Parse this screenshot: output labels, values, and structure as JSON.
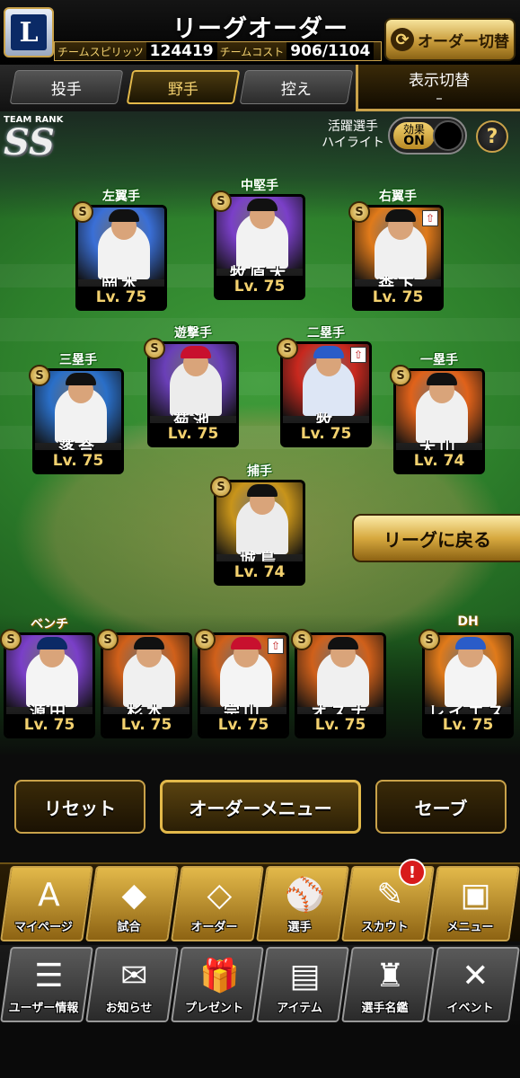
{
  "header": {
    "title": "リーグオーダー",
    "logo_letter": "L",
    "spirit_label": "チームスピリッツ",
    "spirit_value": "124419",
    "cost_label": "チームコスト",
    "cost_value": "906/1104",
    "order_switch_label": "オーダー切替"
  },
  "tabs": [
    {
      "label": "投手",
      "active": false
    },
    {
      "label": "野手",
      "active": true
    },
    {
      "label": "控え",
      "active": false
    }
  ],
  "display_toggle": {
    "label": "表示切替",
    "value": "–"
  },
  "team_rank": {
    "label": "TEAM RANK",
    "value": "SS"
  },
  "highlight": {
    "label_line1": "活躍選手",
    "label_line2": "ハイライト",
    "toggle_top": "効果",
    "toggle_bottom": "ON",
    "help": "?"
  },
  "players": [
    {
      "position": "左翼手",
      "name": "岡本",
      "level": "Lv. 75",
      "badge": "S",
      "art": {
        "bg": "#3a6fd6",
        "cap": "#111",
        "body": "#f2f2f2"
      }
    },
    {
      "position": "中堅手",
      "name": "牧原大",
      "level": "Lv. 75",
      "badge": "S",
      "art": {
        "bg": "#7a3fc8",
        "cap": "#111",
        "body": "#f2f2f2"
      }
    },
    {
      "position": "右翼手",
      "name": "森下",
      "level": "Lv. 75",
      "badge": "S",
      "up": true,
      "art": {
        "bg": "#e07a1a",
        "cap": "#111",
        "body": "#f0f0f0"
      }
    },
    {
      "position": "遊撃手",
      "name": "菊池",
      "level": "Lv. 75",
      "badge": "S",
      "art": {
        "bg": "#6a3fb8",
        "cap": "#c8102e",
        "body": "#ececec"
      }
    },
    {
      "position": "二塁手",
      "name": "牧",
      "level": "Lv. 75",
      "badge": "S",
      "up": true,
      "art": {
        "bg": "#c8281e",
        "cap": "#2a5cc8",
        "body": "#dde6f5"
      }
    },
    {
      "position": "三塁手",
      "name": "落合",
      "level": "Lv. 75",
      "badge": "S",
      "art": {
        "bg": "#2a6fc8",
        "cap": "#111",
        "body": "#f2f2f2"
      }
    },
    {
      "position": "一塁手",
      "name": "大山",
      "level": "Lv. 74",
      "badge": "S",
      "art": {
        "bg": "#e0621a",
        "cap": "#111",
        "body": "#f0f0f0"
      }
    },
    {
      "position": "捕手",
      "name": "城島",
      "level": "Lv. 74",
      "badge": "S",
      "art": {
        "bg": "#c8941a",
        "cap": "#111",
        "body": "#ececec"
      }
    },
    {
      "position": "ベンチ",
      "name": "源田",
      "level": "Lv. 75",
      "badge": "S",
      "art": {
        "bg": "#7a3fc8",
        "cap": "#0b2a66",
        "body": "#f4f4f4"
      }
    },
    {
      "position": "",
      "name": "杉本",
      "level": "Lv. 75",
      "badge": "S",
      "art": {
        "bg": "#d0601a",
        "cap": "#111",
        "body": "#f0f0f0"
      }
    },
    {
      "position": "",
      "name": "宗山",
      "level": "Lv. 75",
      "badge": "S",
      "up": true,
      "art": {
        "bg": "#d0601a",
        "cap": "#c8102e",
        "body": "#f4f4f4"
      }
    },
    {
      "position": "",
      "name": "オスナ",
      "level": "Lv. 75",
      "badge": "S",
      "art": {
        "bg": "#d0601a",
        "cap": "#111",
        "body": "#f0f0f0"
      }
    },
    {
      "position": "DH",
      "name": "レイエス",
      "level": "Lv. 75",
      "badge": "S",
      "art": {
        "bg": "#e07a1a",
        "cap": "#2a5cc8",
        "body": "#f4f4f4"
      }
    }
  ],
  "back_to_league": "リーグに戻る",
  "actions": {
    "reset": "リセット",
    "order_menu": "オーダーメニュー",
    "save": "セーブ"
  },
  "nav_primary": [
    {
      "label": "マイページ",
      "icon": "A"
    },
    {
      "label": "試合",
      "icon": "◆"
    },
    {
      "label": "オーダー",
      "icon": "◇"
    },
    {
      "label": "選手",
      "icon": "⚾"
    },
    {
      "label": "スカウト",
      "icon": "✎"
    },
    {
      "label": "メニュー",
      "icon": "▣"
    }
  ],
  "nav_notification": "!",
  "nav_secondary": [
    {
      "label": "ユーザー情報",
      "icon": "☰"
    },
    {
      "label": "お知らせ",
      "icon": "✉"
    },
    {
      "label": "プレゼント",
      "icon": "🎁"
    },
    {
      "label": "アイテム",
      "icon": "▤"
    },
    {
      "label": "選手名鑑",
      "icon": "♜"
    },
    {
      "label": "イベント",
      "icon": "✕"
    }
  ],
  "colors": {
    "gold": "#c9a24a",
    "gold_text": "#f3d16f",
    "field_green": "#2d7f2b",
    "notification_red": "#d81b1b"
  }
}
